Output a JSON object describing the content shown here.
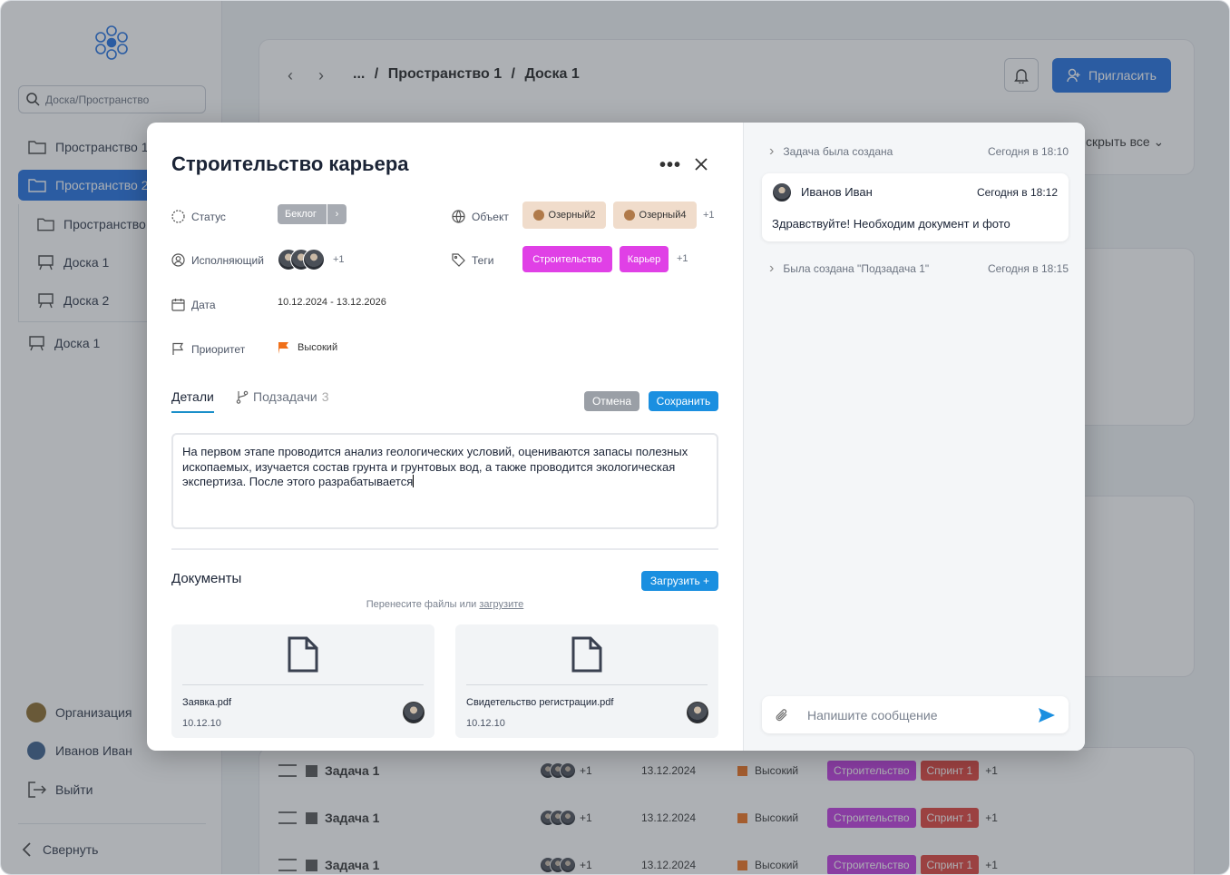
{
  "sidebar": {
    "search_placeholder": "Доска/Пространство",
    "items": [
      {
        "label": "Пространство 1"
      },
      {
        "label": "Пространство 2"
      },
      {
        "label": "Пространство"
      },
      {
        "label": "Доска 1"
      },
      {
        "label": "Доска 2"
      },
      {
        "label": "Доска 1"
      }
    ],
    "org": "Организация",
    "user": "Иванов Иван",
    "logout": "Выйти",
    "collapse": "Свернуть"
  },
  "header": {
    "breadcrumb_ellipsis": "...",
    "breadcrumb_space": "Пространство 1",
    "breadcrumb_board": "Доска 1",
    "sep": "/",
    "invite": "Пригласить",
    "hide_all": "скрыть все"
  },
  "bg_rows": [
    {
      "name": "Задача 1",
      "plus": "+1",
      "date": "13.12.2024",
      "priority": "Высокий",
      "tag1": "Строительство",
      "tag2": "Спринт 1",
      "more": "+1"
    },
    {
      "name": "Задача 1",
      "plus": "+1",
      "date": "13.12.2024",
      "priority": "Высокий",
      "tag1": "Строительство",
      "tag2": "Спринт 1",
      "more": "+1"
    },
    {
      "name": "Задача 1",
      "plus": "+1",
      "date": "13.12.2024",
      "priority": "Высокий",
      "tag1": "Строительство",
      "tag2": "Спринт 1",
      "more": "+1"
    }
  ],
  "task": {
    "title": "Строительство карьера",
    "status_label": "Статус",
    "status_value": "Беклог",
    "object_label": "Объект",
    "objects": [
      "Озерный2",
      "Озерный4"
    ],
    "objects_more": "+1",
    "assignee_label": "Исполняющий",
    "assignee_more": "+1",
    "tags_label": "Теги",
    "tags": [
      "Строительство",
      "Карьер"
    ],
    "tags_more": "+1",
    "date_label": "Дата",
    "date_value": "10.12.2024 - 13.12.2026",
    "priority_label": "Приоритет",
    "priority_value": "Высокий",
    "tab_details": "Детали",
    "tab_subtasks": "Подзадачи",
    "subtasks_count": "3",
    "cancel": "Отмена",
    "save": "Сохранить",
    "description": "На первом этапе проводится анализ геологических условий, оцениваются запасы полезных ископаемых, изучается состав грунта и грунтовых вод, а также проводится экологическая экспертиза. После этого разрабатывается",
    "documents_title": "Документы",
    "upload": "Загрузить +",
    "drop_text": "Перенесите файлы или ",
    "drop_link": "загрузите",
    "docs": [
      {
        "name": "Заявка.pdf",
        "date": "10.12.10"
      },
      {
        "name": "Свидетельство регистрации.pdf",
        "date": "10.12.10"
      }
    ]
  },
  "activity": {
    "created": "Задача была создана",
    "created_time": "Сегодня в 18:10",
    "comment_author": "Иванов Иван",
    "comment_time": "Сегодня в 18:12",
    "comment_text": "Здравствуйте! Необходим документ и фото",
    "subtask_created": "Была создана \"Подзадача 1\"",
    "subtask_time": "Сегодня в 18:15",
    "message_placeholder": "Напишите сообщение"
  },
  "colors": {
    "primary": "#1f6fe0",
    "tag_pink": "#e040e6",
    "save_blue": "#1a8fe0",
    "cancel_gray": "#9a9fa6",
    "sprint_red": "#e0403a",
    "tag_purple": "#c13ae0",
    "priority_orange": "#f0701a"
  }
}
